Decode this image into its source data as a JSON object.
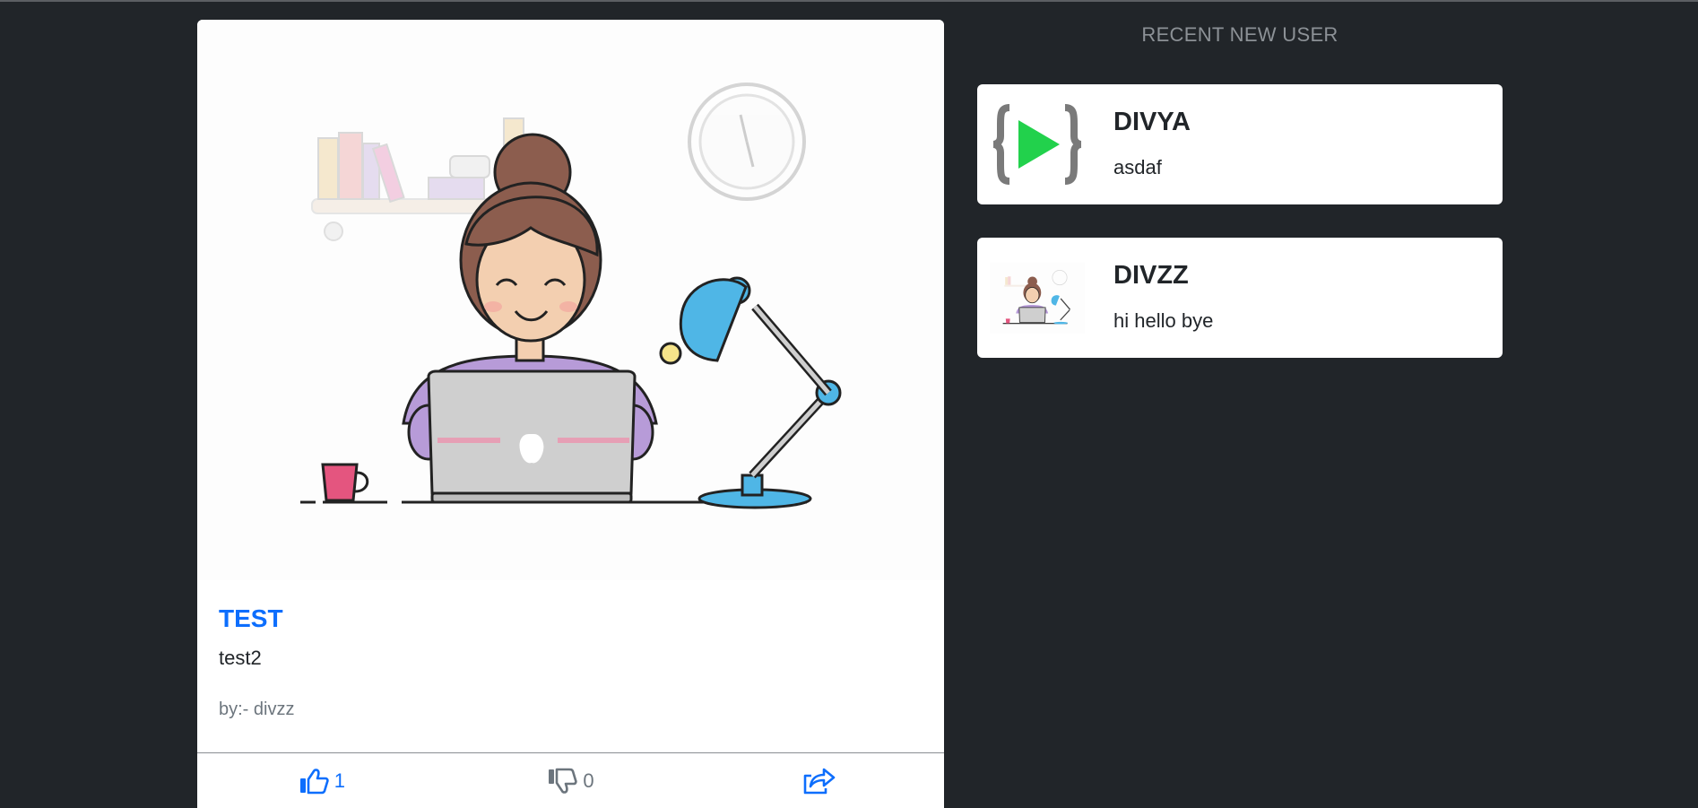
{
  "post": {
    "title": "TEST",
    "text": "test2",
    "author": "by:- divzz",
    "likes": "1",
    "dislikes": "0",
    "like_icon": "thumbs-up-icon",
    "dislike_icon": "thumbs-down-icon",
    "share_icon": "share-icon",
    "image": "woman-at-laptop-illustration"
  },
  "recent": {
    "heading": "RECENT NEW USER",
    "users": [
      {
        "name": "DIVYA",
        "bio": "asdaf",
        "avatar": "code-play-logo"
      },
      {
        "name": "DIVZZ",
        "bio": "hi hello bye",
        "avatar": "woman-at-laptop-illustration"
      }
    ]
  },
  "colors": {
    "background": "#212529",
    "accent": "#0d6efd",
    "muted": "#6c757d"
  }
}
